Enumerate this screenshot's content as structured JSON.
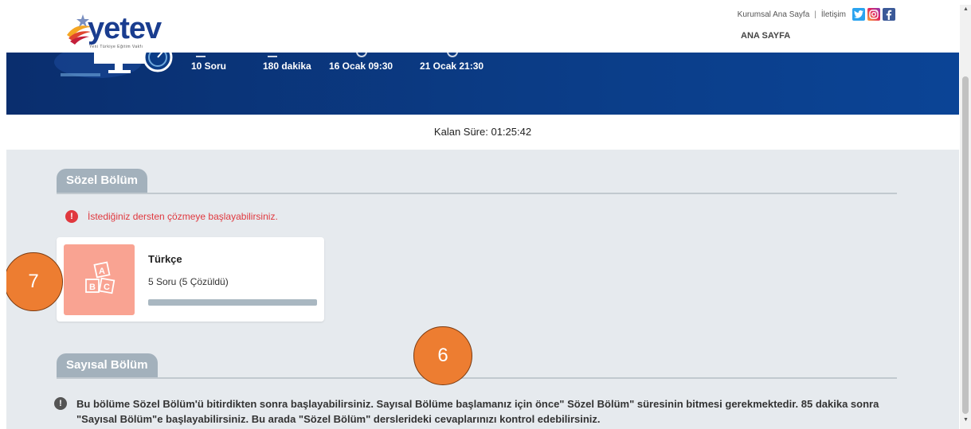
{
  "header": {
    "logo_text": "yetev",
    "logo_tagline": "Yeni Türkiye Eğitim Vakfı",
    "links": [
      "Kurumsal Ana Sayfa",
      "İletişim"
    ],
    "separator": "|",
    "nav_home": "ANA SAYFA",
    "social_icons": [
      "twitter-icon",
      "instagram-icon",
      "facebook-icon"
    ]
  },
  "exam_stats": [
    {
      "label": "10 Soru",
      "icon": "list-icon"
    },
    {
      "label": "180 dakika",
      "icon": "hourglass-icon"
    },
    {
      "label": "16 Ocak 09:30",
      "icon": "clock-icon"
    },
    {
      "label": "21 Ocak 21:30",
      "icon": "search-icon"
    }
  ],
  "timer": {
    "text": "Kalan Süre: 01:25:42"
  },
  "sozel": {
    "title": "Sözel Bölüm",
    "alert": "İstediğiniz dersten çözmeye başlayabilirsiniz.",
    "alert_icon": "!",
    "course": {
      "title": "Türkçe",
      "subtitle": "5 Soru (5 Çözüldü)",
      "progress": 1.0,
      "icon": "abc-blocks-icon"
    }
  },
  "sayisal": {
    "title": "Sayısal Bölüm",
    "info_icon": "!",
    "info": "Bu bölüme Sözel Bölüm'ü bitirdikten sonra başlayabilirsiniz. Sayısal Bölüme başlamanız için önce\" Sözel Bölüm\" süresinin bitmesi gerekmektedir. 85 dakika sonra \"Sayısal Bölüm\"e başlayabilirsiniz. Bu arada \"Sözel Bölüm\" derslerideki cevaplarınızı kontrol edebilirsiniz."
  },
  "annotations": [
    "7",
    "6"
  ],
  "colors": {
    "banner": "#0b3c86",
    "accent_orange": "#ed7d31",
    "alert_red": "#e0383e",
    "card_icon_bg": "#f9a392",
    "section_tab": "#a3b1bc"
  }
}
